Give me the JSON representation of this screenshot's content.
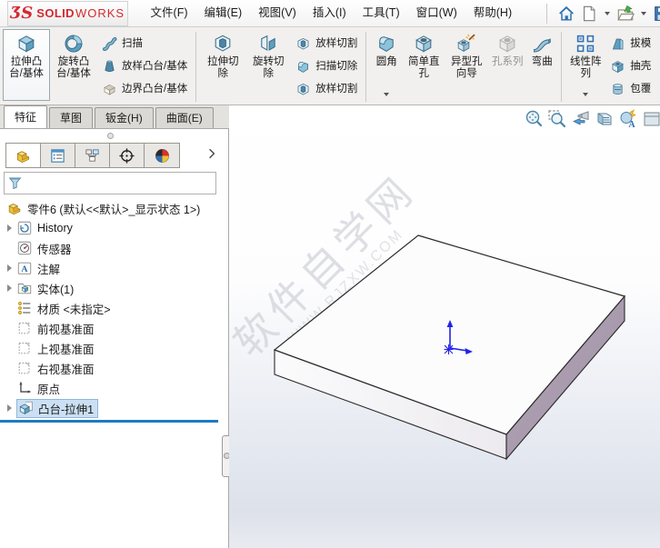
{
  "brand": {
    "ds": "ƷS",
    "solid": "SOLID",
    "works": "WORKS"
  },
  "menu": {
    "items": [
      {
        "label": "文件(F)"
      },
      {
        "label": "编辑(E)"
      },
      {
        "label": "视图(V)"
      },
      {
        "label": "插入(I)"
      },
      {
        "label": "工具(T)"
      },
      {
        "label": "窗口(W)"
      },
      {
        "label": "帮助(H)"
      }
    ]
  },
  "ribbon": {
    "extrude_boss": "拉伸凸台/基体",
    "revolve_boss": "旋转凸台/基体",
    "sweep": "扫描",
    "loft_boss": "放样凸台/基体",
    "boundary_boss": "边界凸台/基体",
    "extrude_cut": "拉伸切除",
    "revolve_cut": "旋转切除",
    "loft_cut": "放样切割",
    "sweep_cut": "扫描切除",
    "loft_cut2": "放样切割",
    "fillet": "圆角",
    "simple_hole": "简单直孔",
    "hole_wizard": "异型孔向导",
    "hole_series": "孔系列",
    "flex": "弯曲",
    "linear_pattern": "线性阵列",
    "draft": "拔模",
    "shell": "抽壳",
    "wrap": "包覆"
  },
  "tabs": {
    "items": [
      {
        "label": "特征",
        "active": true
      },
      {
        "label": "草图",
        "active": false
      },
      {
        "label": "钣金(H)",
        "active": false
      },
      {
        "label": "曲面(E)",
        "active": false
      }
    ]
  },
  "tree": {
    "root": "零件6 (默认<<默认>_显示状态 1>)",
    "items": [
      {
        "label": "History"
      },
      {
        "label": "传感器"
      },
      {
        "label": "注解"
      },
      {
        "label": "实体(1)"
      },
      {
        "label": "材质 <未指定>"
      },
      {
        "label": "前视基准面"
      },
      {
        "label": "上视基准面"
      },
      {
        "label": "右视基准面"
      },
      {
        "label": "原点"
      },
      {
        "label": "凸台-拉伸1",
        "selected": true
      }
    ]
  },
  "viewport": {
    "watermark_title": "软件自学网",
    "watermark_url": "WWW.RJZXW.COM"
  },
  "colors": {
    "brand_red": "#d5292f",
    "rollback_blue": "#1f7ac2",
    "selection_bg": "#cbe0f4",
    "plate_side_face": "#a89aad",
    "origin_marker_blue": "#2323e8",
    "ribbon_bg": "#f1f0ee"
  }
}
